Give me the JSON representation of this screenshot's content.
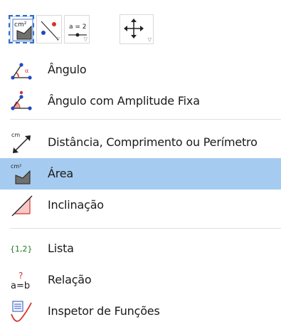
{
  "colors": {
    "selected_row": "#a6cbf0",
    "selected_button_border": "#2f6ec9",
    "separator": "#e0e0e0"
  },
  "toolbar": {
    "buttons": [
      {
        "icon": "area-icon",
        "label": "cm²",
        "selected": true
      },
      {
        "icon": "line-through-point-icon",
        "selected": false
      },
      {
        "icon": "slider-icon",
        "label": "a = 2",
        "selected": false
      },
      {
        "icon": "move-icon",
        "selected": false
      }
    ],
    "dropdown_glyph": "▽"
  },
  "menu": {
    "items": [
      {
        "icon": "angle-icon",
        "label": "Ângulo",
        "selected": false
      },
      {
        "icon": "angle-fixed-size-icon",
        "label": "Ângulo com Amplitude Fixa",
        "selected": false
      },
      {
        "icon": "distance-icon",
        "label": "Distância, Comprimento ou Perímetro",
        "icon_text": "cm",
        "selected": false
      },
      {
        "icon": "area-icon",
        "label": "Área",
        "icon_text": "cm²",
        "selected": true
      },
      {
        "icon": "slope-icon",
        "label": "Inclinação",
        "selected": false
      },
      {
        "icon": "list-icon",
        "label": "Lista",
        "icon_text": "{1,2}",
        "selected": false
      },
      {
        "icon": "relation-icon",
        "label": "Relação",
        "icon_text": "a=b",
        "icon_mark": "?",
        "selected": false
      },
      {
        "icon": "function-inspector-icon",
        "label": "Inspetor de Funções",
        "selected": false
      }
    ]
  }
}
